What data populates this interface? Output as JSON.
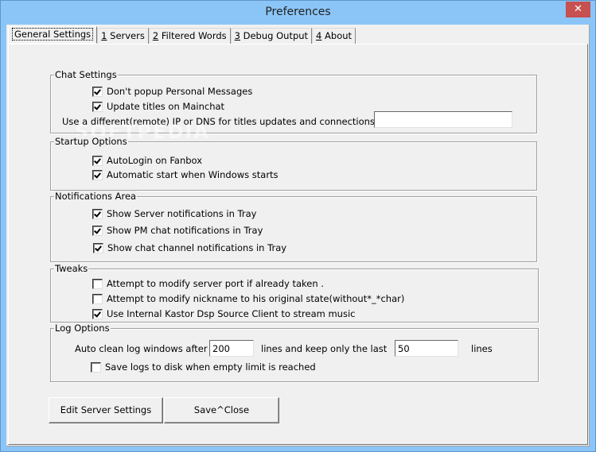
{
  "window": {
    "title": "Preferences",
    "close_glyph": "✕"
  },
  "tabs": [
    {
      "label": "General Settings",
      "active": true
    },
    {
      "mnemonic": "1",
      "label": " Servers"
    },
    {
      "mnemonic": "2",
      "label": " Filtered Words"
    },
    {
      "mnemonic": "3",
      "label": " Debug Output"
    },
    {
      "mnemonic": "4",
      "label": " About"
    }
  ],
  "watermark": "SOFTPEDIA",
  "chat_settings": {
    "label": "Chat Settings",
    "dont_popup_pm": {
      "label": "Don't popup Personal Messages",
      "checked": true
    },
    "update_titles": {
      "label": "Update titles on Mainchat",
      "checked": true
    },
    "remote_ip_label": "Use a different(remote) IP or DNS  for titles updates and connections:",
    "remote_ip_value": ""
  },
  "startup_options": {
    "label": "Startup Options",
    "autologin": {
      "label": "AutoLogin on Fanbox",
      "checked": true
    },
    "autostart": {
      "label": "Automatic start when Windows starts",
      "checked": true
    }
  },
  "notifications_area": {
    "label": "Notifications Area",
    "server_notif": {
      "label": "Show Server notifications in Tray",
      "checked": true
    },
    "pm_notif": {
      "label": "Show PM chat notifications in Tray",
      "checked": true
    },
    "channel_notif": {
      "label": "Show chat channel notifications in Tray",
      "checked": true
    }
  },
  "tweaks": {
    "label": "Tweaks",
    "modify_port": {
      "label": "Attempt to modify server  port if already taken .",
      "checked": false
    },
    "modify_nick": {
      "label": "Attempt to modify nickname to his original  state(without*_*char)",
      "checked": false
    },
    "internal_dsp": {
      "label": "Use Internal Kastor Dsp Source Client to stream music",
      "checked": true
    }
  },
  "log_options": {
    "label": "Log Options",
    "auto_clean_label": "Auto clean log windows after",
    "auto_clean_value": "200",
    "keep_label": "lines  and keep only the last",
    "keep_value": "50",
    "lines_label": "lines",
    "save_to_disk": {
      "label": "Save logs to disk when empty limit is reached",
      "checked": false
    }
  },
  "buttons": {
    "edit_server": "Edit Server Settings",
    "save_close": "Save^Close"
  }
}
